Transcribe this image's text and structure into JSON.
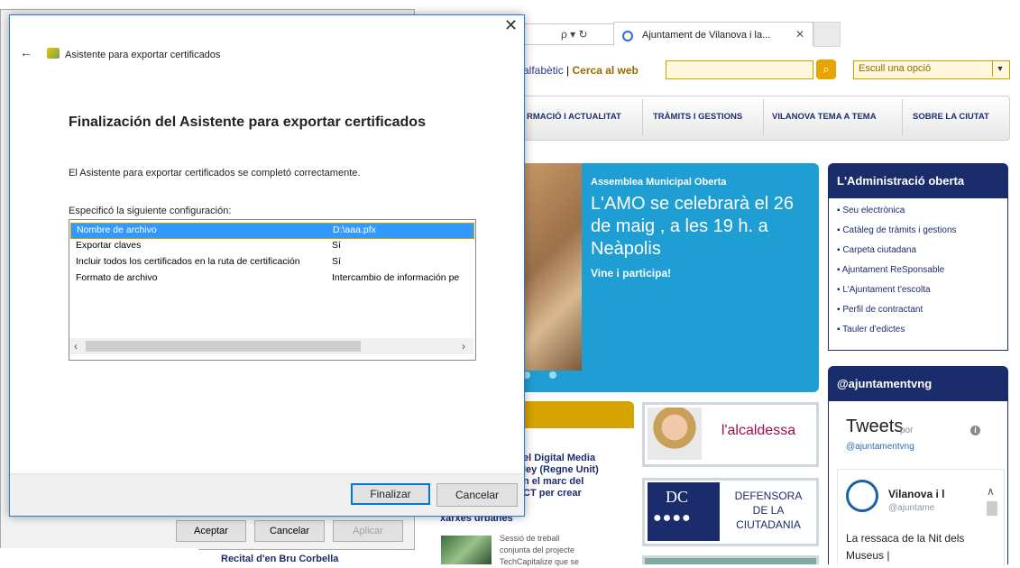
{
  "browser": {
    "addr_controls": "ρ ▾ ↻",
    "tab_label": "Ajuntament de Vilanova i la...",
    "tab_close": "✕"
  },
  "site": {
    "search_links": {
      "alpha": "alfabètic",
      "sep": "|",
      "web": "Cerca al web"
    },
    "select_text": "Escull una opció",
    "nav": [
      "RMACIÓ I ACTUALITAT",
      "TRÀMITS I GESTIONS",
      "VILANOVA TEMA A TEMA",
      "SOBRE LA CIUTAT"
    ],
    "banner": {
      "kicker": "Assemblea Municipal Oberta",
      "title": "L'AMO se celebrarà el 26 de maig , a les 19 h. a Neàpolis",
      "sub": "Vine i participa!"
    },
    "admin": {
      "title": "L'Administració oberta",
      "items": [
        "Seu electrònica",
        "Catàleg de tràmits i gestions",
        "Carpeta ciutadana",
        "Ajuntament ReSponsable",
        "L'Ajuntament t'escolta",
        "Perfil de contractant",
        "Tauler d'edictes"
      ]
    },
    "twitter": {
      "header": "@ajuntamentvng",
      "title": "Tweets",
      "por": "por",
      "handle": "@ajuntamentvng",
      "name": "Vilanova i l",
      "at": "@ajuntame",
      "text": "La ressaca de la Nit dels Museus |"
    },
    "news": {
      "headline_lines": [
        "el Digital Media",
        "ley (Regne Unit)",
        "n el marc del",
        "CT per crear"
      ],
      "kicker": "xarxes urbanes",
      "sub_lines": [
        "Sessió de treball",
        "conjunta del projecte",
        "TechCapitalize que se"
      ],
      "recital": "Recital d'en Bru Corbella"
    },
    "tiles": {
      "alcaldessa": "l'alcaldessa",
      "dc_letters": "DC",
      "dc_lines": [
        "DEFENSORA",
        "DE LA",
        "CIUTADANIA"
      ]
    }
  },
  "bg_dialog": {
    "buttons": [
      "Aceptar",
      "Cancelar",
      "Aplicar"
    ]
  },
  "wizard": {
    "window_title": "Asistente para exportar certificados",
    "heading": "Finalización del Asistente para exportar certificados",
    "done_text": "El Asistente para exportar certificados se completó correctamente.",
    "spec_label": "Especificó la siguiente configuración:",
    "rows": [
      {
        "key": "Nombre de archivo",
        "value": "D:\\aaa.pfx"
      },
      {
        "key": "Exportar claves",
        "value": "Sí"
      },
      {
        "key": "Incluir todos los certificados en la ruta de certificación",
        "value": "Sí"
      },
      {
        "key": "Formato de archivo",
        "value": "Intercambio de información pe"
      }
    ],
    "finish_label": "Finalizar",
    "cancel_label": "Cancelar"
  }
}
